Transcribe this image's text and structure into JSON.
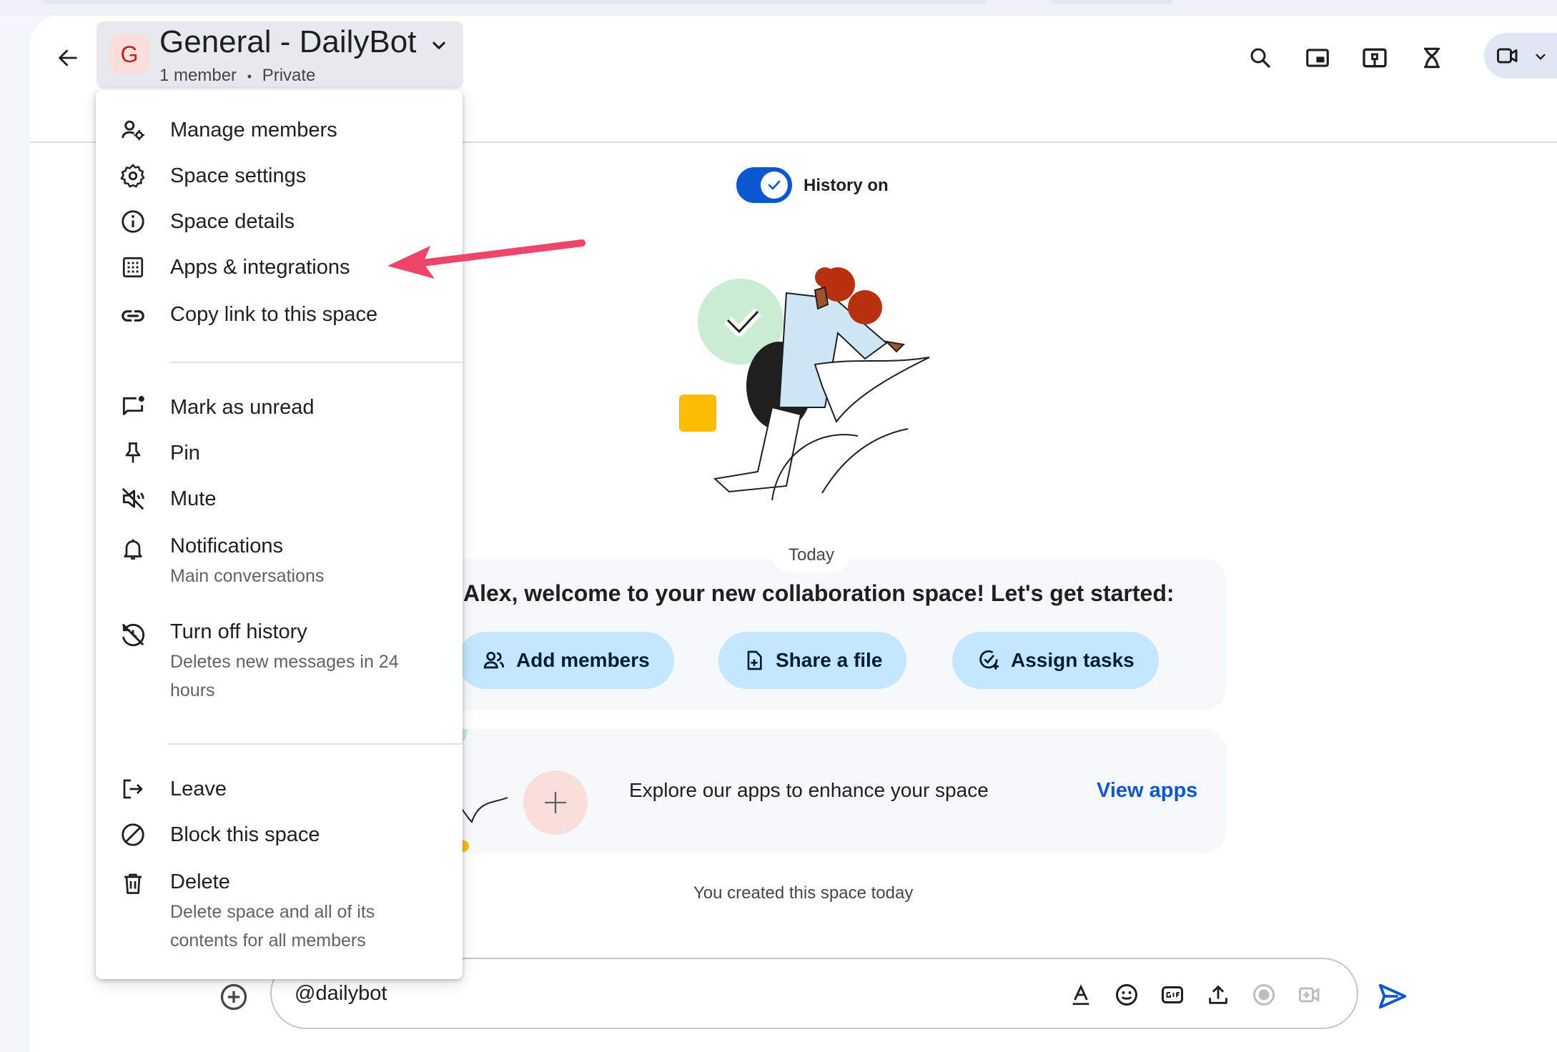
{
  "header": {
    "avatar_letter": "G",
    "space_title": "General - DailyBot",
    "member_count": "1 member",
    "separator": "•",
    "privacy": "Private"
  },
  "history": {
    "label": "History on",
    "enabled": true
  },
  "menu": {
    "items": [
      {
        "label": "Manage members",
        "icon": "manage-members-icon"
      },
      {
        "label": "Space settings",
        "icon": "gear-icon"
      },
      {
        "label": "Space details",
        "icon": "info-icon"
      },
      {
        "label": "Apps & integrations",
        "icon": "apps-grid-icon"
      },
      {
        "label": "Copy link to this space",
        "icon": "link-icon"
      },
      {
        "label": "Mark as unread",
        "icon": "mark-unread-icon"
      },
      {
        "label": "Pin",
        "icon": "pin-icon"
      },
      {
        "label": "Mute",
        "icon": "mute-icon"
      },
      {
        "label": "Notifications",
        "description": "Main conversations",
        "icon": "bell-icon"
      },
      {
        "label": "Turn off history",
        "description_line1": "Deletes new messages in 24",
        "description_line2": "hours",
        "icon": "history-off-icon"
      },
      {
        "label": "Leave",
        "icon": "leave-icon"
      },
      {
        "label": "Block this space",
        "icon": "block-icon"
      },
      {
        "label": "Delete",
        "description_line1": "Delete space and all of its",
        "description_line2": "contents for all members",
        "icon": "trash-icon"
      }
    ]
  },
  "conversation": {
    "date_divider": "Today",
    "welcome": "Alex, welcome to your new collaboration space! Let's get started:",
    "actions": [
      {
        "label": "Add members",
        "icon": "people-icon"
      },
      {
        "label": "Share a file",
        "icon": "file-add-icon"
      },
      {
        "label": "Assign tasks",
        "icon": "task-add-icon"
      }
    ],
    "explore_text": "Explore our apps to enhance your space",
    "view_apps": "View apps",
    "created_note": "You created this space today"
  },
  "composer": {
    "value": "@dailybot"
  },
  "colors": {
    "accent": "#0b57d0",
    "pill_bg": "#c2e7ff",
    "annotation_arrow": "#f0456a"
  }
}
